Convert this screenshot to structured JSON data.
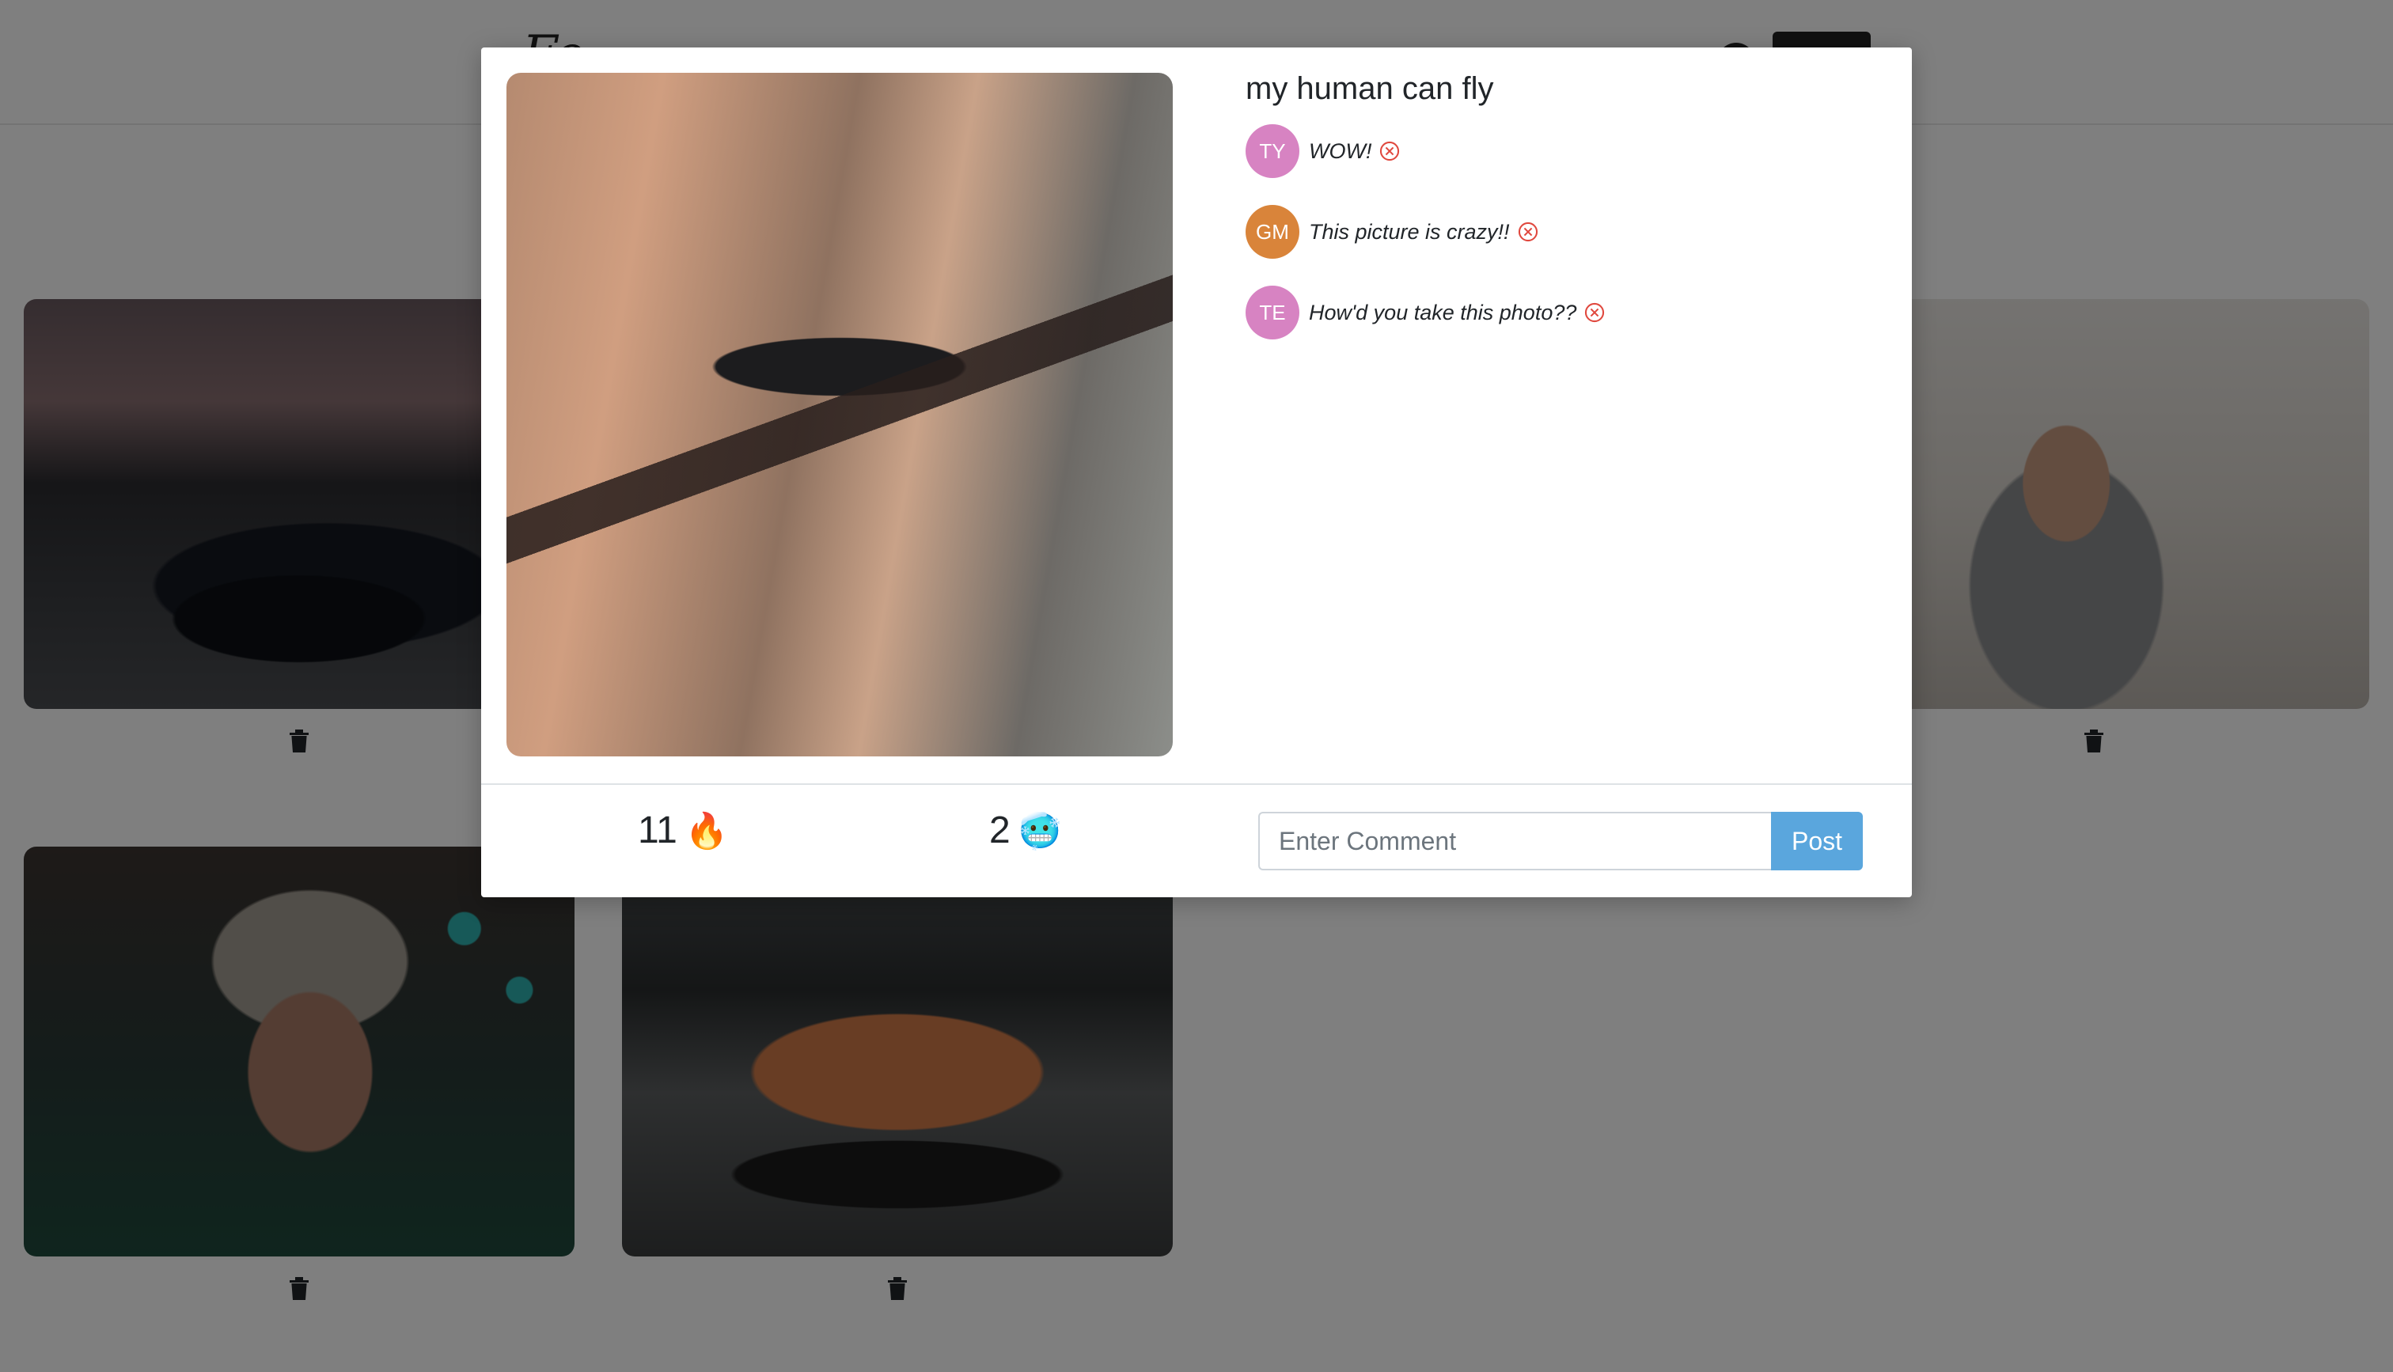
{
  "navbar": {
    "brand": "F ... fly",
    "brand_partial": "Fo"
  },
  "gallery": {
    "cards": [
      {
        "id": "tesla",
        "photo": "black-tesla-sunset",
        "trash_icon": "trash-icon"
      },
      {
        "id": "beard-man",
        "photo": "man-with-spatula",
        "trash_icon": "trash-icon"
      },
      {
        "id": "goggles",
        "photo": "man-with-goggles",
        "trash_icon": "trash-icon"
      },
      {
        "id": "porsche",
        "photo": "orange-porsche",
        "trash_icon": "trash-icon"
      }
    ]
  },
  "modal": {
    "title": "my human can fly",
    "photo": "man-floating-in-hallway",
    "comments": [
      {
        "initials": "TY",
        "text": "WOW!",
        "avatar_color": "#d783c2"
      },
      {
        "initials": "GM",
        "text": "This picture is crazy!!",
        "avatar_color": "#d9843a"
      },
      {
        "initials": "TE",
        "text": "How'd you take this photo??",
        "avatar_color": "#d783c2"
      }
    ],
    "reactions": [
      {
        "count": "11",
        "emoji": "🔥",
        "name": "fire"
      },
      {
        "count": "2",
        "emoji": "🥶",
        "name": "cold-face"
      }
    ],
    "comment_input": {
      "placeholder": "Enter Comment",
      "value": ""
    },
    "post_label": "Post"
  },
  "colors": {
    "accent": "#5aa6dd",
    "delete": "#e0483e",
    "overlay": "rgba(0,0,0,0.5)"
  }
}
